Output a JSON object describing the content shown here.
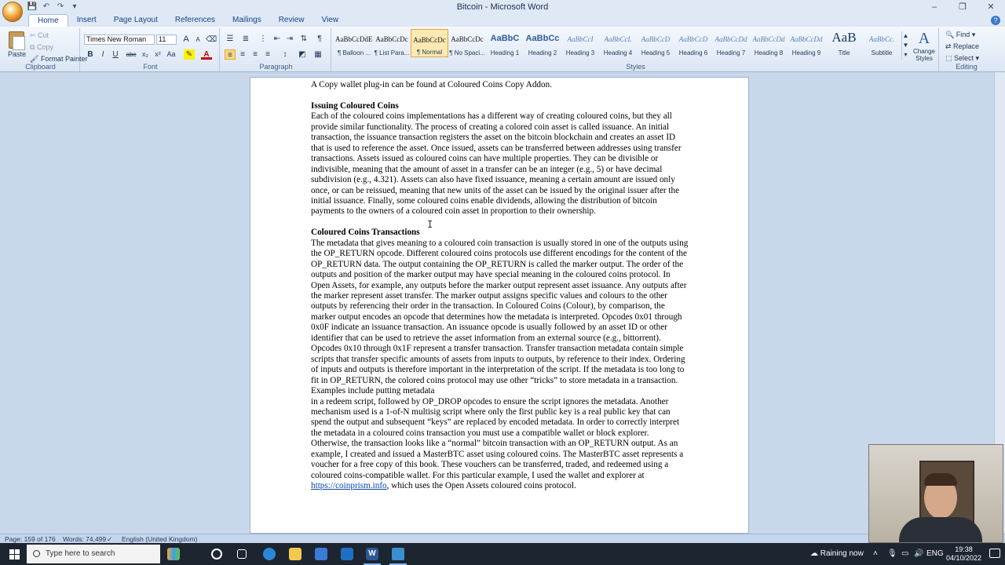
{
  "window": {
    "title": "Bitcoin - Microsoft Word",
    "controls": [
      "–",
      "❐",
      "✕"
    ]
  },
  "quick_access": [
    "💾",
    "↶",
    "↷",
    "▾"
  ],
  "tabs": [
    {
      "label": "Home",
      "active": true
    },
    {
      "label": "Insert"
    },
    {
      "label": "Page Layout"
    },
    {
      "label": "References"
    },
    {
      "label": "Mailings"
    },
    {
      "label": "Review"
    },
    {
      "label": "View"
    }
  ],
  "ribbon": {
    "clipboard": {
      "label": "Clipboard",
      "paste": "Paste",
      "cut": "Cut",
      "copy": "Copy",
      "format_painter": "Format Painter"
    },
    "font": {
      "label": "Font",
      "family": "Times New Roman",
      "size": "11",
      "bold": "B",
      "italic": "I",
      "underline": "U",
      "strike": "abc",
      "subscript": "x₂",
      "superscript": "x²",
      "change_case": "Aa",
      "grow": "A",
      "shrink": "A"
    },
    "paragraph": {
      "label": "Paragraph"
    },
    "styles": {
      "label": "Styles",
      "items": [
        {
          "preview": "AaBbCcDdEe",
          "name": "¶ Balloon ..."
        },
        {
          "preview": "AaBbCcDc",
          "name": "¶ List Para..."
        },
        {
          "preview": "AaBbCcDc",
          "name": "¶ Normal",
          "active": true
        },
        {
          "preview": "AaBbCcDc",
          "name": "¶ No Spaci..."
        },
        {
          "preview": "AaBbC",
          "name": "Heading 1",
          "kind": "h"
        },
        {
          "preview": "AaBbCc",
          "name": "Heading 2",
          "kind": "h"
        },
        {
          "preview": "AaBbCcI",
          "name": "Heading 3",
          "kind": "s"
        },
        {
          "preview": "AaBbCcL",
          "name": "Heading 4",
          "kind": "s"
        },
        {
          "preview": "AaBbCcD",
          "name": "Heading 5",
          "kind": "s"
        },
        {
          "preview": "AaBbCcD",
          "name": "Heading 6",
          "kind": "s"
        },
        {
          "preview": "AaBbCcDd",
          "name": "Heading 7",
          "kind": "s"
        },
        {
          "preview": "AaBbCcDd",
          "name": "Heading 8",
          "kind": "s"
        },
        {
          "preview": "AaBbCcDd",
          "name": "Heading 9",
          "kind": "s"
        },
        {
          "preview": "AaB",
          "name": "Title",
          "kind": "t"
        },
        {
          "preview": "AaBbCc.",
          "name": "Subtitle",
          "kind": "s"
        }
      ],
      "change_styles": "Change Styles"
    },
    "editing": {
      "label": "Editing",
      "find": "Find",
      "replace": "Replace",
      "select": "Select"
    }
  },
  "document": {
    "intro": "A Copy wallet plug-in can be found at Coloured Coins Copy Addon.",
    "heading1": "Issuing Coloured Coins",
    "para1": "Each of the coloured coins implementations has a different way of creating coloured coins, but they all provide similar functionality. The process of creating a colored coin asset is called issuance. An initial transaction, the issuance transaction registers the asset on the bitcoin blockchain and creates an asset ID that is used to reference the asset. Once issued, assets can be transferred between addresses using transfer transactions. Assets issued as coloured coins can have multiple properties. They can be divisible or indivisible, meaning that the amount of asset in a transfer can be an integer (e.g., 5) or have decimal subdivision (e.g., 4.321). Assets can also have fixed issuance, meaning a certain amount are issued only once, or can be reissued, meaning that new units of the asset can be issued by the original issuer after the initial issuance. Finally, some coloured coins enable dividends, allowing the distribution of bitcoin payments to the owners of a coloured coin asset in proportion to their ownership.",
    "heading2": "Coloured Coins Transactions",
    "para2": "The metadata that gives meaning to a coloured coin transaction is usually stored in one of the outputs using the OP_RETURN opcode. Different coloured coins protocols use different encodings for the content of the OP_RETURN data. The output containing the OP_RETURN is called the marker output. The order of the outputs and position of the marker output may have special meaning in the coloured coins protocol. In Open Assets, for example, any outputs before the marker output represent asset issuance. Any outputs after the marker represent asset transfer. The marker output assigns specific values and colours to the other outputs by referencing their order in the transaction. In Coloured Coins (Colour), by comparison, the marker output encodes an opcode that determines how the metadata is interpreted. Opcodes 0x01 through 0x0F indicate an issuance transaction. An issuance opcode is usually followed by an asset ID or other identifier that can be used to retrieve the asset information from an external source (e.g., bittorrent). Opcodes 0x10 through 0x1F represent a transfer transaction. Transfer transaction metadata contain simple scripts that transfer specific amounts of assets from inputs to outputs, by reference to their index. Ordering of inputs and outputs is therefore important in the interpretation of the script. If the metadata is too long to fit in OP_RETURN, the colored coins protocol may use other “tricks” to store metadata in a transaction. Examples include putting metadata",
    "para3_pre": "in a redeem script, followed by OP_DROP opcodes to ensure the script ignores the metadata. Another mechanism used is a 1-of-N multisig script where only the first public key is a real public key that can spend the output and subsequent “keys” are replaced by encoded metadata. In order to correctly interpret the metadata in a coloured coins transaction you must use a compatible wallet or block explorer. Otherwise, the transaction looks like a “normal” bitcoin transaction with an OP_RETURN output. As an example, I created and issued a MasterBTC asset using coloured coins. The MasterBTC asset represents a voucher for a free copy of this book. These vouchers can be transferred, traded, and redeemed using a coloured coins-compatible wallet. For this particular example, I used the wallet and explorer at ",
    "para3_link": "https://coinprism.info",
    "para3_post": ", which uses the Open Assets coloured coins protocol."
  },
  "status": {
    "page": "Page: 159 of 176",
    "words": "Words: 74,499",
    "language": "English (United Kingdom)"
  },
  "taskbar": {
    "search_placeholder": "Type here to search",
    "weather": "Raining now",
    "language": "ENG",
    "time": "19:38",
    "date": "04/10/2022"
  }
}
